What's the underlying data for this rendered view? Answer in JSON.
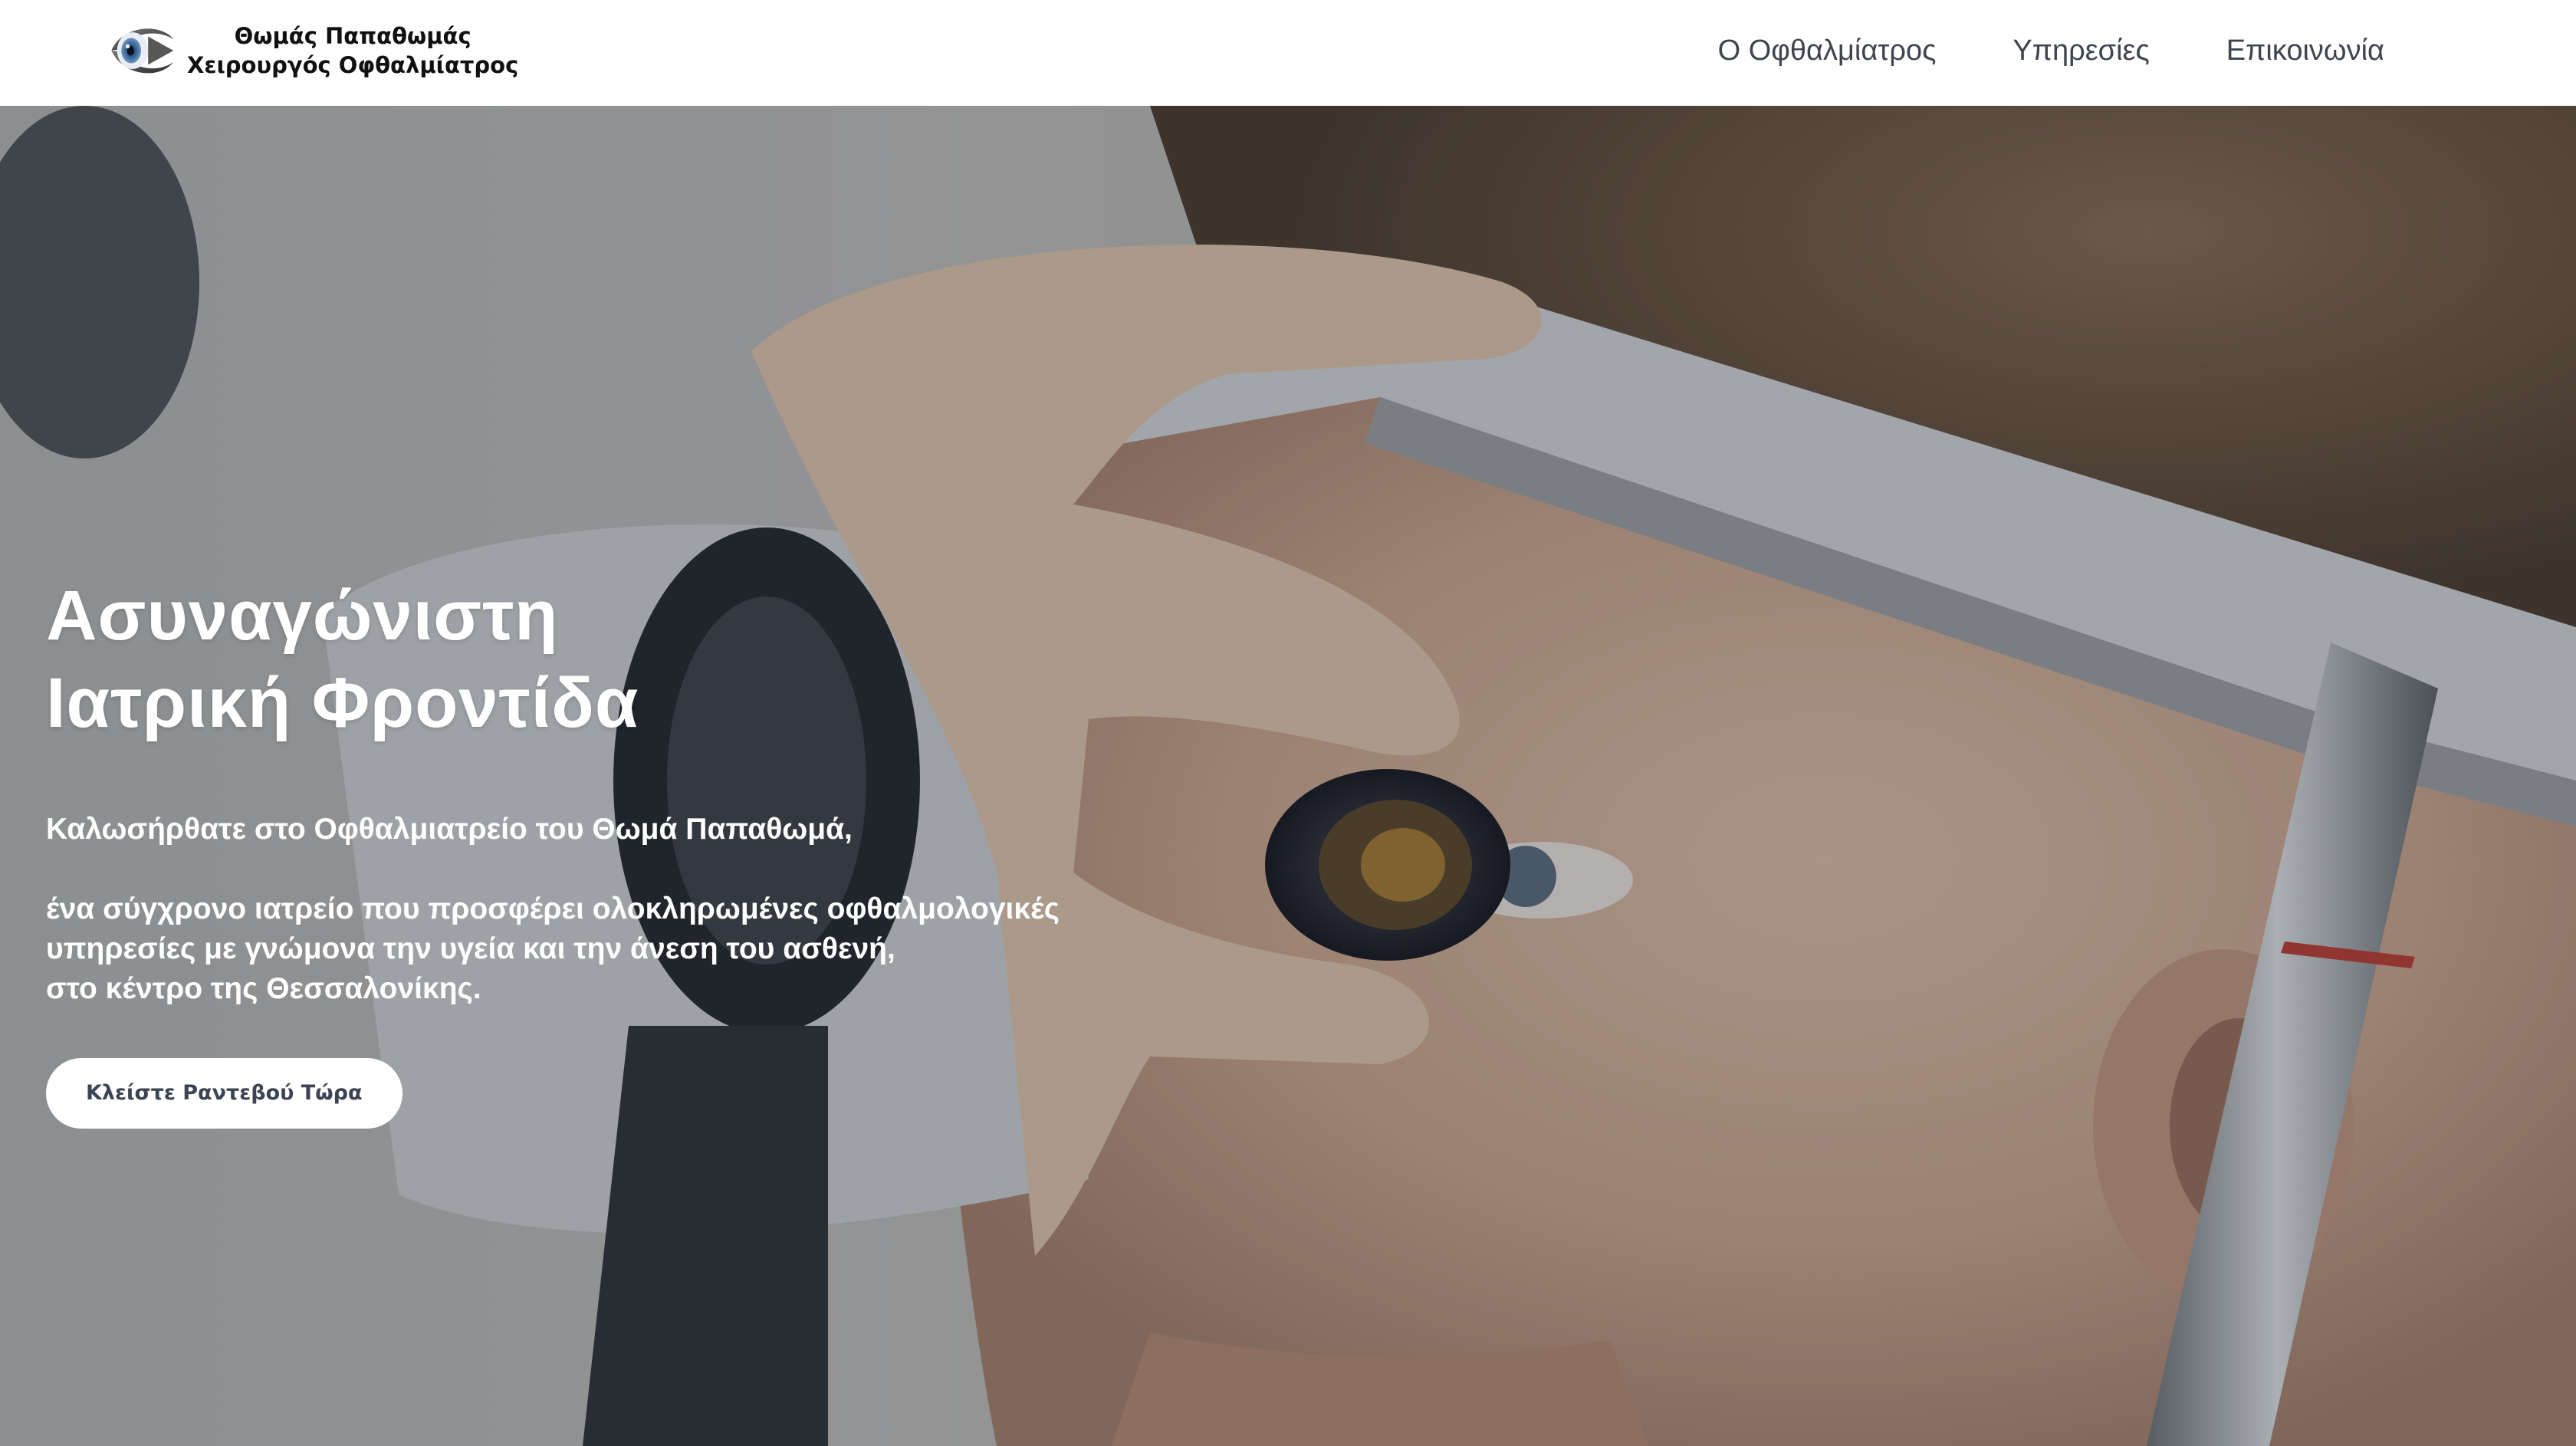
{
  "header": {
    "brand_line1": "Θωμάς Παπαθωμάς",
    "brand_line2": "Χειρουργός Οφθαλμίατρος",
    "logo_icon": "eye-logo-icon",
    "nav": [
      {
        "label": "Ο Οφθαλμίατρος"
      },
      {
        "label": "Υπηρεσίες"
      },
      {
        "label": "Επικοινωνία"
      }
    ]
  },
  "hero": {
    "title_line1": "Ασυναγώνιστη",
    "title_line2": "Ιατρική Φροντίδα",
    "welcome": "Καλωσήρθατε στο Οφθαλμιατρείο του Θωμά Παπαθωμά,",
    "desc_line1": "ένα σύγχρονο ιατρείο που προσφέρει ολοκληρωμένες οφθαλμολογικές",
    "desc_line2": "υπηρεσίες με γνώμονα την υγεία και την άνεση του ασθενή,",
    "desc_line3": "στο κέντρο της Θεσσαλονίκης.",
    "cta_label": "Κλείστε Ραντεβού Τώρα",
    "background_image": "patient-at-slit-lamp-eye-exam-photo"
  },
  "colors": {
    "header_bg": "#ffffff",
    "nav_text": "#3f4450",
    "hero_text": "#ffffff",
    "cta_bg": "#ffffff",
    "cta_text": "#3c4454"
  }
}
